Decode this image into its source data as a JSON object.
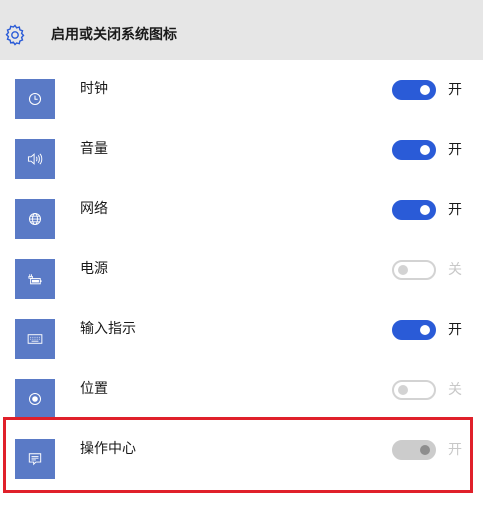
{
  "header": {
    "title": "启用或关闭系统图标",
    "icon": "gear-icon"
  },
  "colors": {
    "tile": "#5a7ac6",
    "toggle_on": "#2a5bd7",
    "highlight": "#e0202a"
  },
  "items": [
    {
      "label": "时钟",
      "icon": "clock-icon",
      "state": "on",
      "state_label": "开"
    },
    {
      "label": "音量",
      "icon": "speaker-icon",
      "state": "on",
      "state_label": "开"
    },
    {
      "label": "网络",
      "icon": "globe-icon",
      "state": "on",
      "state_label": "开"
    },
    {
      "label": "电源",
      "icon": "battery-plug-icon",
      "state": "off",
      "state_label": "关"
    },
    {
      "label": "输入指示",
      "icon": "keyboard-icon",
      "state": "on",
      "state_label": "开"
    },
    {
      "label": "位置",
      "icon": "location-icon",
      "state": "off",
      "state_label": "关"
    },
    {
      "label": "操作中心",
      "icon": "action-center-icon",
      "state": "disabled",
      "state_label": "开"
    }
  ]
}
